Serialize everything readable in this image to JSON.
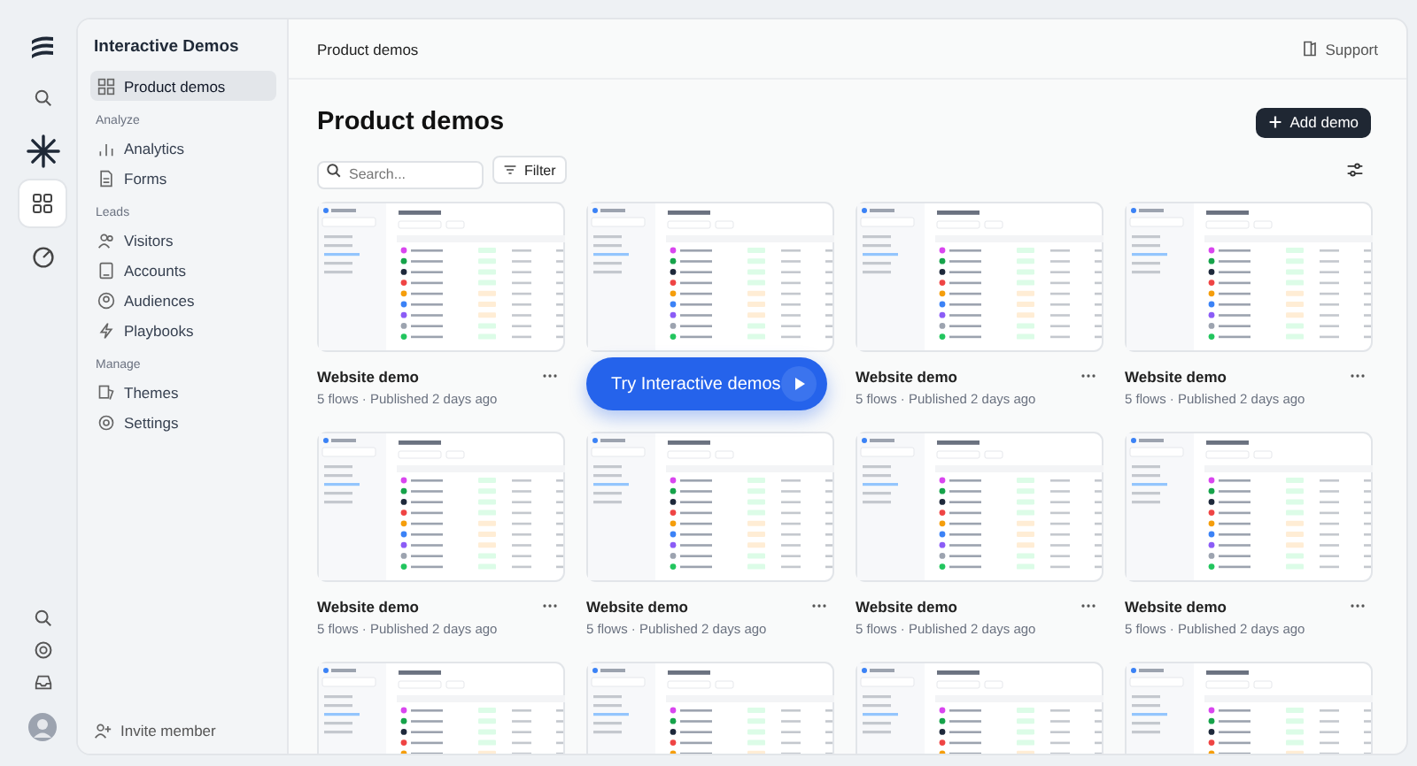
{
  "rail": {
    "top_items": [
      {
        "kind": "search",
        "selected": false
      },
      {
        "kind": "spark",
        "selected": false
      },
      {
        "kind": "grid",
        "selected": true
      },
      {
        "kind": "gauge",
        "selected": false
      }
    ],
    "bottom_items": [
      {
        "kind": "search"
      },
      {
        "kind": "globe"
      },
      {
        "kind": "inbox"
      },
      {
        "kind": "avatar"
      }
    ]
  },
  "sidebar": {
    "title": "Interactive Demos",
    "sections": [
      {
        "items": [
          {
            "label": "Product demos",
            "kind": "grid",
            "selected": true
          }
        ]
      },
      {
        "heading": "Analyze",
        "items": [
          {
            "label": "Analytics",
            "kind": "chart",
            "selected": false
          },
          {
            "label": "Forms",
            "kind": "doc",
            "selected": false
          }
        ]
      },
      {
        "heading": "Leads",
        "items": [
          {
            "label": "Visitors",
            "kind": "people",
            "selected": false
          },
          {
            "label": "Accounts",
            "kind": "building",
            "selected": false
          },
          {
            "label": "Audiences",
            "kind": "person",
            "selected": false
          },
          {
            "label": "Playbooks",
            "kind": "bolt",
            "selected": false
          }
        ]
      },
      {
        "heading": "Manage",
        "items": [
          {
            "label": "Themes",
            "kind": "palette",
            "selected": false
          },
          {
            "label": "Settings",
            "kind": "gear",
            "selected": false
          }
        ]
      }
    ],
    "footer": "Invite member"
  },
  "header": {
    "breadcrumb": "Product demos",
    "support": "Support"
  },
  "page": {
    "title": "Product demos",
    "add_button": "Add demo",
    "search": {
      "placeholder": "Search..."
    },
    "filter": "Filter"
  },
  "cards": [
    {
      "kind": "titled",
      "title": "Website demo",
      "meta": "5 flows · Published 2 days ago"
    },
    {
      "kind": "preview"
    },
    {
      "kind": "titled",
      "title": "Website demo",
      "meta": "5 flows · Published 2 days ago"
    },
    {
      "kind": "titled",
      "title": "Website demo",
      "meta": "5 flows · Published 2 days ago"
    },
    {
      "kind": "titled",
      "title": "Website demo",
      "meta": "5 flows · Published 2 days ago"
    },
    {
      "kind": "titled",
      "title": "Website demo",
      "meta": "5 flows · Published 2 days ago"
    },
    {
      "kind": "titled",
      "title": "Website demo",
      "meta": "5 flows · Published 2 days ago"
    },
    {
      "kind": "titled",
      "title": "Website demo",
      "meta": "5 flows · Published 2 days ago"
    },
    {
      "kind": "preview"
    },
    {
      "kind": "preview"
    },
    {
      "kind": "preview"
    },
    {
      "kind": "preview"
    }
  ],
  "overlay_button": "Try Interactive demos"
}
